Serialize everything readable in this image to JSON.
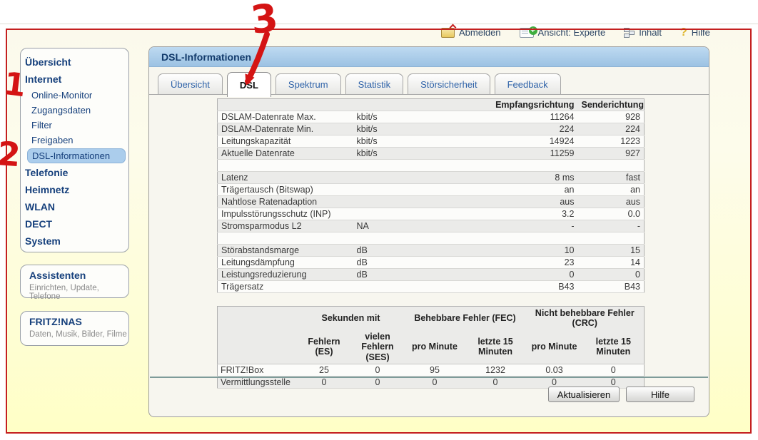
{
  "colors": {
    "annotation_red": "#c41f1f",
    "panel_header_blue": "#a9cbe8",
    "selected_item_bg": "#abcdec",
    "page_background_yellow": "#ffffc6"
  },
  "top_menu": {
    "items": [
      {
        "icon": "logout-icon",
        "label": "Abmelden"
      },
      {
        "icon": "view-mode-icon",
        "label": "Ansicht: Experte"
      },
      {
        "icon": "sitemap-icon",
        "label": "Inhalt"
      },
      {
        "icon": "help-icon",
        "label": "Hilfe"
      }
    ]
  },
  "sidebar": {
    "items": [
      {
        "label": "Übersicht",
        "type": "main",
        "selected": false
      },
      {
        "label": "Internet",
        "type": "main",
        "selected": false
      },
      {
        "label": "Online-Monitor",
        "type": "sub",
        "selected": false
      },
      {
        "label": "Zugangsdaten",
        "type": "sub",
        "selected": false
      },
      {
        "label": "Filter",
        "type": "sub",
        "selected": false
      },
      {
        "label": "Freigaben",
        "type": "sub",
        "selected": false
      },
      {
        "label": "DSL-Informationen",
        "type": "sub",
        "selected": true
      },
      {
        "label": "Telefonie",
        "type": "main",
        "selected": false
      },
      {
        "label": "Heimnetz",
        "type": "main",
        "selected": false
      },
      {
        "label": "WLAN",
        "type": "main",
        "selected": false
      },
      {
        "label": "DECT",
        "type": "main",
        "selected": false
      },
      {
        "label": "System",
        "type": "main",
        "selected": false
      }
    ],
    "assistenten": {
      "title": "Assistenten",
      "subtitle": "Einrichten, Update, Telefone"
    },
    "fritznas": {
      "title": "FRITZ!NAS",
      "subtitle": "Daten, Musik, Bilder, Filme"
    }
  },
  "panel": {
    "title": "DSL-Informationen",
    "tabs": [
      "Übersicht",
      "DSL",
      "Spektrum",
      "Statistik",
      "Störsicherheit",
      "Feedback"
    ],
    "active_tab": "DSL",
    "buttons": {
      "refresh": "Aktualisieren",
      "help": "Hilfe"
    }
  },
  "dsl_table": {
    "col_headers": [
      "",
      "",
      "Empfangsrichtung",
      "Senderichtung"
    ],
    "rows": [
      [
        "DSLAM-Datenrate Max.",
        "kbit/s",
        "11264",
        "928"
      ],
      [
        "DSLAM-Datenrate Min.",
        "kbit/s",
        "224",
        "224"
      ],
      [
        "Leitungskapazität",
        "kbit/s",
        "14924",
        "1223"
      ],
      [
        "Aktuelle Datenrate",
        "kbit/s",
        "11259",
        "927"
      ],
      [
        "",
        "",
        "",
        ""
      ],
      [
        "Latenz",
        "",
        "8 ms",
        "fast"
      ],
      [
        "Trägertausch (Bitswap)",
        "",
        "an",
        "an"
      ],
      [
        "Nahtlose Ratenadaption",
        "",
        "aus",
        "aus"
      ],
      [
        "Impulsstörungsschutz (INP)",
        "",
        "3.2",
        "0.0"
      ],
      [
        "Stromsparmodus L2",
        "NA",
        "-",
        "-"
      ],
      [
        "",
        "",
        "",
        ""
      ],
      [
        "Störabstandsmarge",
        "dB",
        "10",
        "15"
      ],
      [
        "Leitungsdämpfung",
        "dB",
        "23",
        "14"
      ],
      [
        "Leistungsreduzierung",
        "dB",
        "0",
        "0"
      ],
      [
        "Trägersatz",
        "",
        "B43",
        "B43"
      ]
    ]
  },
  "error_table": {
    "group_headers": [
      "",
      "Sekunden mit",
      "Behebbare Fehler (FEC)",
      "Nicht behebbare Fehler (CRC)"
    ],
    "sub_headers": [
      "",
      "Fehlern (ES)",
      "vielen Fehlern (SES)",
      "pro Minute",
      "letzte 15 Minuten",
      "pro Minute",
      "letzte 15 Minuten"
    ],
    "rows": [
      [
        "FRITZ!Box",
        "25",
        "0",
        "95",
        "1232",
        "0.03",
        "0"
      ],
      [
        "Vermittlungsstelle",
        "0",
        "0",
        "0",
        "0",
        "0",
        "0"
      ]
    ]
  },
  "annotations": {
    "step1": "1",
    "step2": "2",
    "step3": "3"
  }
}
